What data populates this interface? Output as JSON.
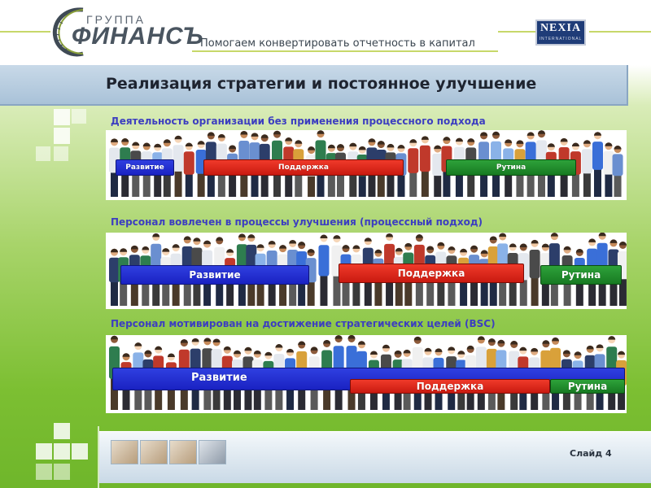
{
  "header": {
    "logo_top": "ГРУППА",
    "logo_main": "ФИНАНСЪ",
    "slogan": "Помогаем конвертировать отчетность в капитал",
    "partner_name": "NEXIA",
    "partner_sub": "INTERNATIONAL"
  },
  "title": "Реализация стратегии и постоянное улучшение",
  "sections": [
    {
      "heading": "Деятельность организации без применения процессного подхода",
      "bands": {
        "development": "Развитие",
        "support": "Поддержка",
        "routine": "Рутина"
      }
    },
    {
      "heading": "Персонал вовлечен в процессы улучшения (процессный подход)",
      "bands": {
        "development": "Развитие",
        "support": "Поддержка",
        "routine": "Рутина"
      }
    },
    {
      "heading": "Персонал мотивирован на достижение стратегических целей (BSC)",
      "bands": {
        "development": "Развитие",
        "support": "Поддержка",
        "routine": "Рутина"
      }
    }
  ],
  "footer": {
    "slide_label": "Слайд 4"
  },
  "colors": {
    "development": "#1a22c2",
    "support": "#d7261a",
    "routine": "#1d8a2a",
    "heading": "#3c3ec0",
    "background": "#7cbf32"
  },
  "icons": [
    "finance-group-logo-icon",
    "nexia-logo-icon",
    "people-crowd-icon"
  ]
}
